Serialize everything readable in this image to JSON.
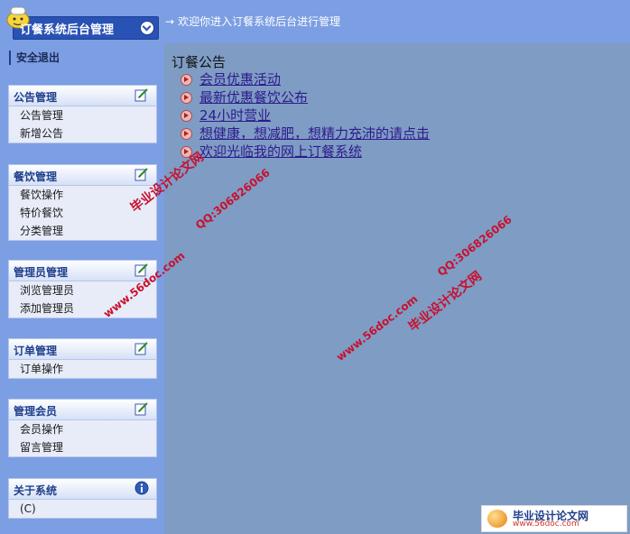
{
  "header": {
    "app_title": "订餐系统后台管理",
    "welcome": "欢迎你进入订餐系统后台进行管理",
    "arrow": "→"
  },
  "sidebar": {
    "logout": "安全退出",
    "panels": [
      {
        "title": "公告管理",
        "items": [
          "公告管理",
          "新增公告"
        ]
      },
      {
        "title": "餐饮管理",
        "items": [
          "餐饮操作",
          "特价餐饮",
          "分类管理"
        ]
      },
      {
        "title": "管理员管理",
        "items": [
          "浏览管理员",
          "添加管理员"
        ]
      },
      {
        "title": "订单管理",
        "items": [
          "订单操作"
        ]
      },
      {
        "title": "管理会员",
        "items": [
          "会员操作",
          "留言管理"
        ]
      },
      {
        "title": "关于系统",
        "items": [
          "(C)"
        ]
      }
    ]
  },
  "main": {
    "notice_title": "订餐公告",
    "notices": [
      "会员优惠活动",
      "最新优惠餐饮公布",
      "24小时营业",
      "想健康，想减肥，想精力充沛的请点击",
      "欢迎光临我的网上订餐系统"
    ]
  },
  "watermarks": {
    "cn": "毕业设计论文网",
    "web": "www.56doc.com",
    "qq": "QQ:306826066",
    "logo_cn": "毕业设计论文网",
    "logo_web": "www.56doc.com"
  }
}
